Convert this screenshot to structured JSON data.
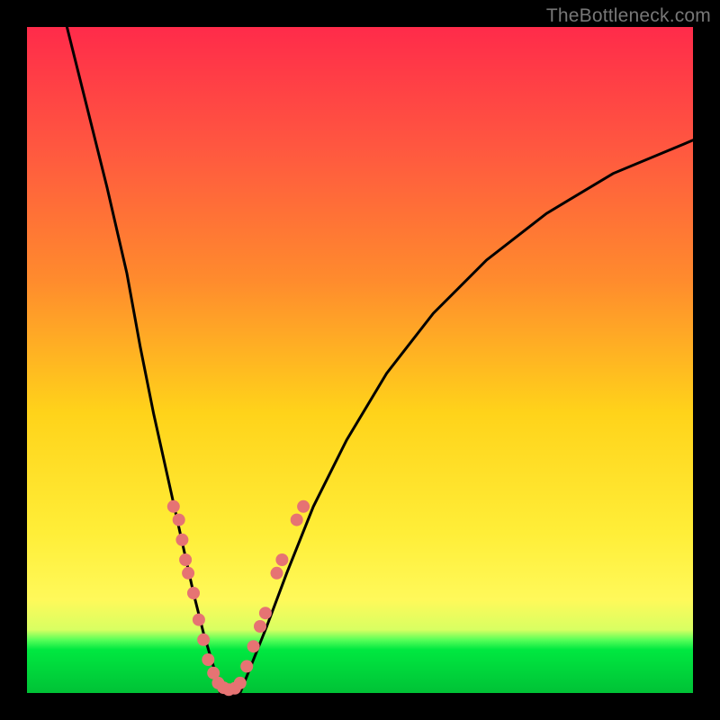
{
  "watermark": {
    "text": "TheBottleneck.com"
  },
  "chart_data": {
    "type": "line",
    "title": "",
    "xlabel": "",
    "ylabel": "",
    "xlim": [
      0,
      100
    ],
    "ylim": [
      0,
      100
    ],
    "background_gradient": {
      "top": "#ff2b4a",
      "mid_upper": "#ff8b2d",
      "mid": "#ffee38",
      "band": "#59ff59",
      "bottom": "#00c236"
    },
    "series": [
      {
        "name": "left-branch",
        "stroke": "#000000",
        "x": [
          6,
          9,
          12,
          15,
          17,
          19,
          21,
          23,
          25,
          26.5,
          28,
          29
        ],
        "y": [
          100,
          88,
          76,
          63,
          52,
          42,
          33,
          24,
          15,
          9,
          4,
          0
        ]
      },
      {
        "name": "right-branch",
        "stroke": "#000000",
        "x": [
          32,
          34,
          36,
          39,
          43,
          48,
          54,
          61,
          69,
          78,
          88,
          100
        ],
        "y": [
          0,
          5,
          10,
          18,
          28,
          38,
          48,
          57,
          65,
          72,
          78,
          83
        ]
      }
    ],
    "scatter": {
      "name": "dots",
      "fill": "#e67373",
      "radius_px": 7,
      "points": [
        {
          "x": 22.0,
          "y": 28
        },
        {
          "x": 22.8,
          "y": 26
        },
        {
          "x": 23.3,
          "y": 23
        },
        {
          "x": 23.8,
          "y": 20
        },
        {
          "x": 24.2,
          "y": 18
        },
        {
          "x": 25.0,
          "y": 15
        },
        {
          "x": 25.8,
          "y": 11
        },
        {
          "x": 26.5,
          "y": 8
        },
        {
          "x": 27.2,
          "y": 5
        },
        {
          "x": 28.0,
          "y": 3
        },
        {
          "x": 28.7,
          "y": 1.5
        },
        {
          "x": 29.5,
          "y": 0.8
        },
        {
          "x": 30.3,
          "y": 0.5
        },
        {
          "x": 31.2,
          "y": 0.7
        },
        {
          "x": 32.0,
          "y": 1.5
        },
        {
          "x": 33.0,
          "y": 4
        },
        {
          "x": 34.0,
          "y": 7
        },
        {
          "x": 35.0,
          "y": 10
        },
        {
          "x": 35.8,
          "y": 12
        },
        {
          "x": 37.5,
          "y": 18
        },
        {
          "x": 38.3,
          "y": 20
        },
        {
          "x": 40.5,
          "y": 26
        },
        {
          "x": 41.5,
          "y": 28
        }
      ]
    }
  }
}
